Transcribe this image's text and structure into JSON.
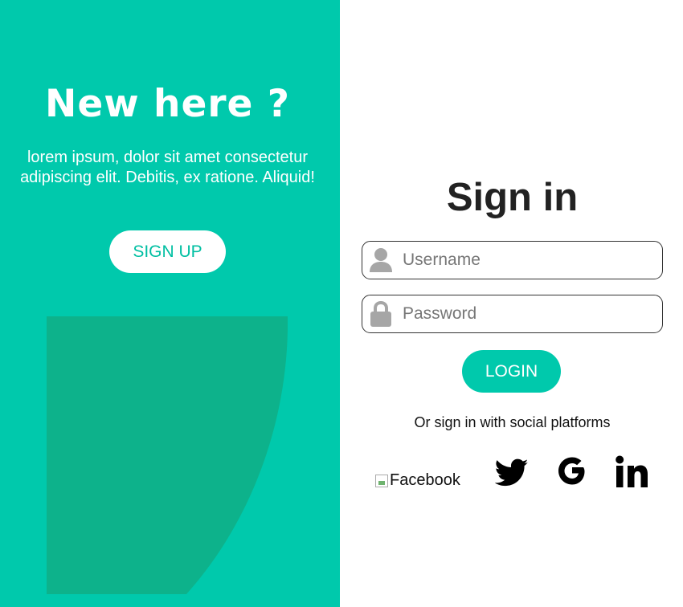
{
  "left_panel": {
    "title": "New here ?",
    "text": "lorem ipsum, dolor sit amet consectetur adipiscing elit. Debitis, ex ratione. Aliquid!",
    "signup_label": "SIGN UP"
  },
  "form": {
    "title": "Sign in",
    "username_placeholder": "Username",
    "password_placeholder": "Password",
    "login_label": "LOGIN",
    "social_text": "Or sign in with social platforms"
  },
  "social": {
    "facebook_alt": "Facebook",
    "icons": [
      "twitter-icon",
      "google-icon",
      "linkedin-icon"
    ]
  },
  "colors": {
    "accent": "#00c9ac",
    "illustration": "#0db28b",
    "text_dark": "#222222",
    "input_icon": "#a6a6a6"
  }
}
